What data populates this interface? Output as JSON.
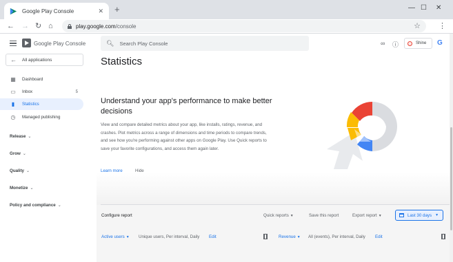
{
  "browser": {
    "tab_title": "Google Play Console",
    "new_tab_glyph": "+",
    "window_controls": [
      "—",
      "☐",
      "✕"
    ],
    "url_host": "play.google.com",
    "url_path": "/console"
  },
  "header": {
    "app_name": "Google Play Console",
    "search_placeholder": "Search Play Console",
    "profile_name": "Shine"
  },
  "sidebar": {
    "all_apps_label": "All applications",
    "items": [
      {
        "label": "Dashboard",
        "icon": "dashboard-icon",
        "count": ""
      },
      {
        "label": "Inbox",
        "icon": "inbox-icon",
        "count": "5"
      },
      {
        "label": "Statistics",
        "icon": "bar-chart-icon",
        "count": "",
        "active": true
      },
      {
        "label": "Managed publishing",
        "icon": "publishing-icon",
        "count": ""
      }
    ],
    "sections": [
      "Release",
      "Grow",
      "Quality",
      "Monetize",
      "Policy and compliance"
    ]
  },
  "main": {
    "title": "Statistics",
    "promo_title": "Understand your app's performance to make better decisions",
    "promo_body": "View and compare detailed metrics about your app, like installs, ratings, revenue, and crashes. Plot metrics across a range of dimensions and time periods to compare trends, and see how you're performing against other apps on Google Play. Use Quick reports to save your favorite configurations, and access them again later.",
    "learn_more": "Learn more",
    "hide": "Hide"
  },
  "report": {
    "configure_label": "Configure report",
    "quick_reports": "Quick reports",
    "save_report": "Save this report",
    "export_report": "Export report",
    "date_range": "Last 30 days",
    "metric1": {
      "name": "Active users",
      "detail": "Unique users, Per interval, Daily",
      "edit": "Edit"
    },
    "metric2": {
      "name": "Revenue",
      "detail": "All (events), Per interval, Daily",
      "edit": "Edit"
    }
  },
  "colors": {
    "accent": "#1a73e8",
    "active_bg": "#e8f0fe"
  }
}
